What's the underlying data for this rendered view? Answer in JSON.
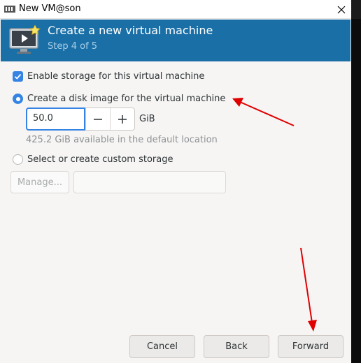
{
  "window": {
    "title": "New VM@son"
  },
  "banner": {
    "title": "Create a new virtual machine",
    "step": "Step 4 of 5"
  },
  "storage": {
    "enable_label": "Enable storage for this virtual machine",
    "enable_checked": true,
    "create_disk_label": "Create a disk image for the virtual machine",
    "create_disk_selected": true,
    "disk_size_value": "50.0",
    "disk_size_unit": "GiB",
    "available_text": "425.2 GiB available in the default location",
    "custom_label": "Select or create custom storage",
    "custom_selected": false,
    "manage_label": "Manage...",
    "custom_path_value": ""
  },
  "buttons": {
    "cancel": "Cancel",
    "back": "Back",
    "forward": "Forward"
  },
  "colors": {
    "banner": "#1a6fa6",
    "accent": "#3584e4",
    "annotation_arrow": "#e00000"
  },
  "icons": {
    "titlebar": "virt-manager-icon",
    "banner": "new-vm-monitor-icon",
    "close": "close-icon",
    "minus": "minus-icon",
    "plus": "plus-icon"
  }
}
